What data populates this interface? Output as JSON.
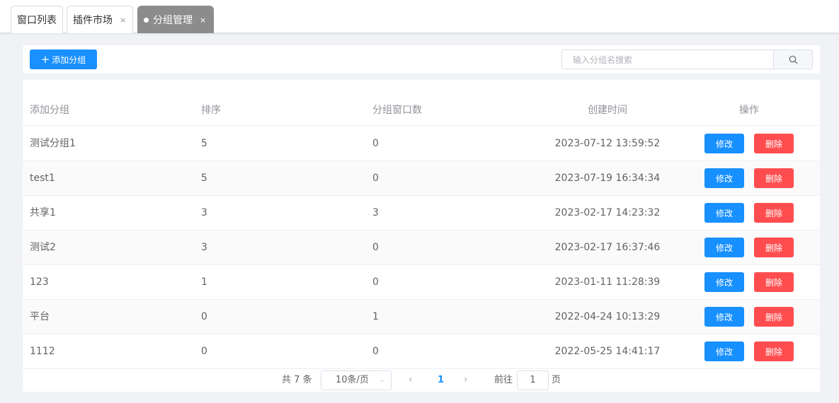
{
  "tabs": [
    {
      "label": "窗口列表",
      "closable": false,
      "active": false
    },
    {
      "label": "插件市场",
      "closable": true,
      "active": false
    },
    {
      "label": "分组管理",
      "closable": true,
      "active": true
    }
  ],
  "tab_close_glyph": "×",
  "toolbar": {
    "add_label": "添加分组",
    "add_icon": "plus-icon",
    "search_placeholder": "输入分组名搜索",
    "search_icon": "search-icon"
  },
  "table": {
    "headers": [
      "添加分组",
      "排序",
      "分组窗口数",
      "创建时间",
      "操作"
    ],
    "rows": [
      {
        "name": "测试分组1",
        "sort": "5",
        "count": "0",
        "created": "2023-07-12 13:59:52"
      },
      {
        "name": "test1",
        "sort": "5",
        "count": "0",
        "created": "2023-07-19 16:34:34"
      },
      {
        "name": "共享1",
        "sort": "3",
        "count": "3",
        "created": "2023-02-17 14:23:32"
      },
      {
        "name": "测试2",
        "sort": "3",
        "count": "0",
        "created": "2023-02-17 16:37:46"
      },
      {
        "name": "123",
        "sort": "1",
        "count": "0",
        "created": "2023-01-11 11:28:39"
      },
      {
        "name": "平台",
        "sort": "0",
        "count": "1",
        "created": "2022-04-24 10:13:29"
      },
      {
        "name": "1112",
        "sort": "0",
        "count": "0",
        "created": "2022-05-25 14:41:17"
      }
    ],
    "edit_label": "修改",
    "delete_label": "删除"
  },
  "pagination": {
    "total_text": "共 7 条",
    "page_size": "10条/页",
    "prev": "‹",
    "current_page": "1",
    "next": "›",
    "goto_label": "前往",
    "goto_value": "1",
    "page_suffix": "页"
  },
  "colors": {
    "primary": "#1890ff",
    "danger": "#ff4d4f",
    "active_tab": "#8c8c8c"
  }
}
